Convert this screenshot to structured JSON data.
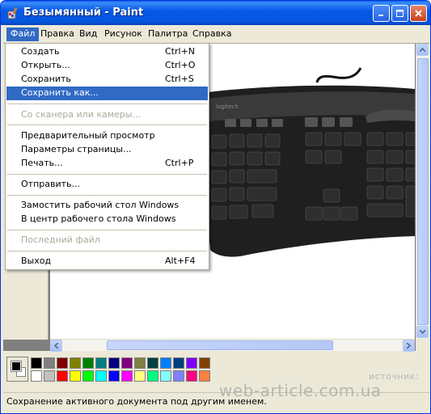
{
  "window": {
    "title": "Безымянный - Paint"
  },
  "menubar": {
    "items": [
      {
        "label": "Файл"
      },
      {
        "label": "Правка"
      },
      {
        "label": "Вид"
      },
      {
        "label": "Рисунок"
      },
      {
        "label": "Палитра"
      },
      {
        "label": "Справка"
      }
    ]
  },
  "file_menu": {
    "items": [
      {
        "label": "Создать",
        "shortcut": "Ctrl+N"
      },
      {
        "label": "Открыть...",
        "shortcut": "Ctrl+O"
      },
      {
        "label": "Сохранить",
        "shortcut": "Ctrl+S"
      },
      {
        "label": "Сохранить как...",
        "shortcut": "",
        "highlighted": true
      },
      {
        "label": "Со сканера или камеры...",
        "shortcut": "",
        "disabled": true
      },
      {
        "label": "Предварительный просмотр",
        "shortcut": ""
      },
      {
        "label": "Параметры страницы...",
        "shortcut": ""
      },
      {
        "label": "Печать...",
        "shortcut": "Ctrl+P"
      },
      {
        "label": "Отправить...",
        "shortcut": ""
      },
      {
        "label": "Замостить рабочий стол Windows",
        "shortcut": ""
      },
      {
        "label": "В центр рабочего стола Windows",
        "shortcut": ""
      },
      {
        "label": "Последний файл",
        "shortcut": "",
        "disabled": true
      },
      {
        "label": "Выход",
        "shortcut": "Alt+F4"
      }
    ]
  },
  "palette": {
    "foreground": "#000000",
    "background": "#ffffff",
    "row1": [
      "#000000",
      "#808080",
      "#800000",
      "#808000",
      "#008000",
      "#008080",
      "#000080",
      "#800080",
      "#808040",
      "#004040",
      "#0080ff",
      "#004080",
      "#8000ff",
      "#804000"
    ],
    "row2": [
      "#ffffff",
      "#c0c0c0",
      "#ff0000",
      "#ffff00",
      "#00ff00",
      "#00ffff",
      "#0000ff",
      "#ff00ff",
      "#ffff80",
      "#00ff80",
      "#80ffff",
      "#8080ff",
      "#ff0080",
      "#ff8040"
    ]
  },
  "statusbar": {
    "text": "Сохранение активного документа под другим именем."
  },
  "watermark": {
    "source_label": "источник:",
    "site": "web-article.com.ua"
  }
}
